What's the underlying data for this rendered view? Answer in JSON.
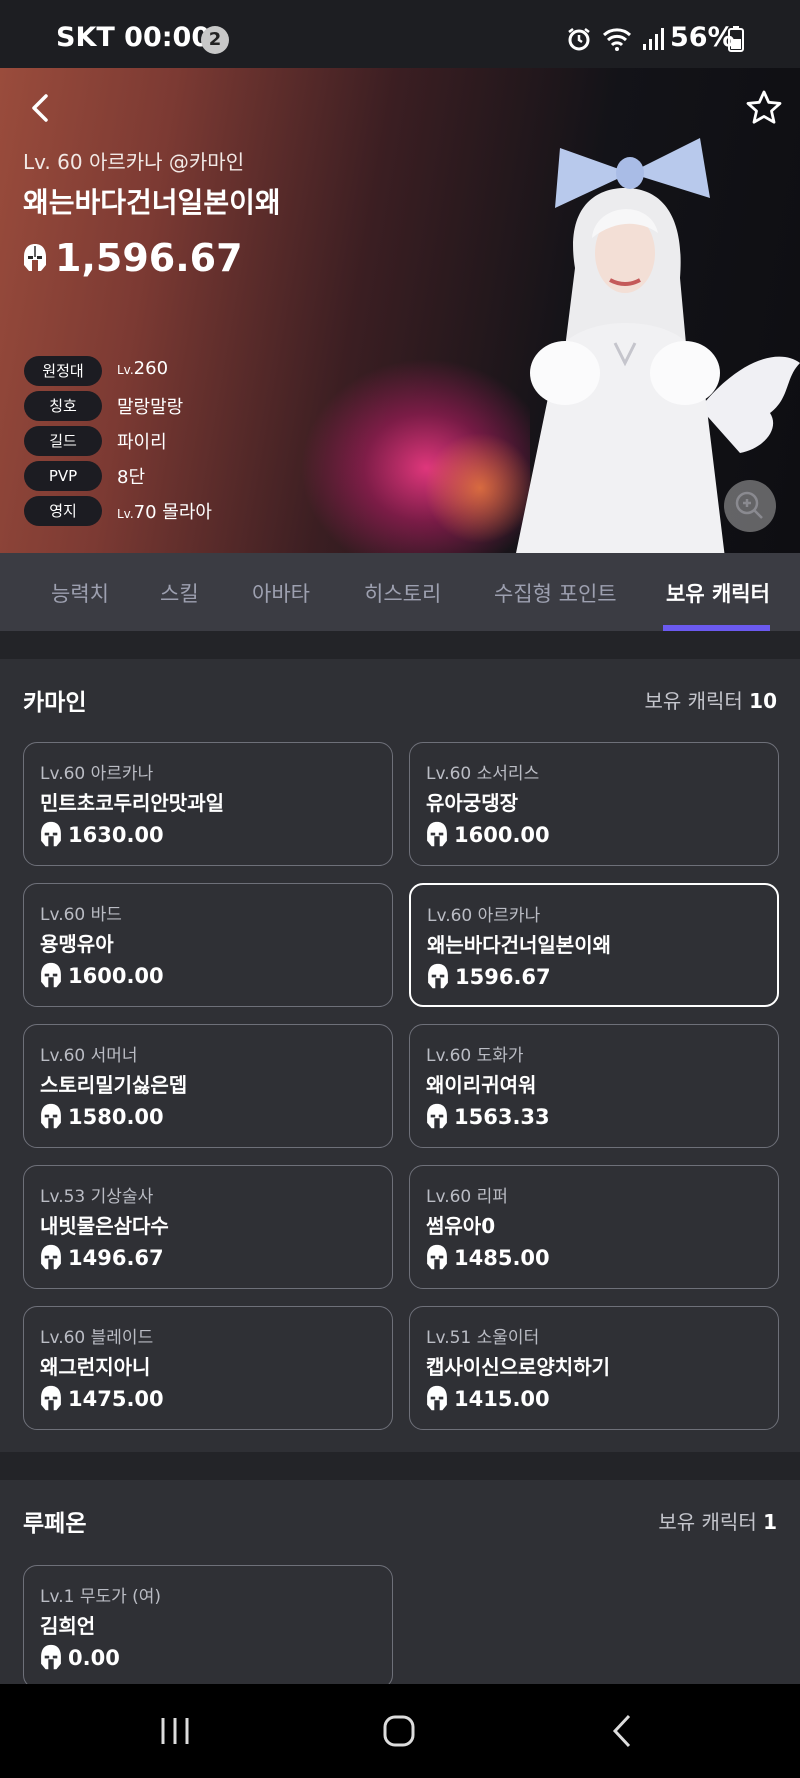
{
  "status_bar": {
    "carrier_time": "SKT 00:00",
    "notification_count": "2",
    "battery": "56%"
  },
  "hero": {
    "class_line": "Lv. 60 아르카나 @카마인",
    "name": "왜는바다건너일본이왜",
    "item_level": "1,596.67",
    "info": [
      {
        "label": "원정대",
        "prefix": "Lv.",
        "value": "260"
      },
      {
        "label": "칭호",
        "prefix": "",
        "value": "말랑말랑"
      },
      {
        "label": "길드",
        "prefix": "",
        "value": "파이리"
      },
      {
        "label": "PVP",
        "prefix": "",
        "value": "8단"
      },
      {
        "label": "영지",
        "prefix": "Lv.",
        "value": "70 몰라아"
      }
    ]
  },
  "tabs": [
    "능력치",
    "스킬",
    "아바타",
    "히스토리",
    "수집형 포인트",
    "보유 캐릭터"
  ],
  "active_tab": "보유 캐릭터",
  "servers": [
    {
      "name": "카마인",
      "count_label": "보유 캐릭터",
      "count": "10",
      "characters": [
        {
          "cls": "Lv.60 아르카나",
          "name": "민트초코두리안맛과일",
          "level": "1630.00"
        },
        {
          "cls": "Lv.60 소서리스",
          "name": "유아궁댕장",
          "level": "1600.00"
        },
        {
          "cls": "Lv.60 바드",
          "name": "용맹유아",
          "level": "1600.00"
        },
        {
          "cls": "Lv.60 아르카나",
          "name": "왜는바다건너일본이왜",
          "level": "1596.67"
        },
        {
          "cls": "Lv.60 서머너",
          "name": "스토리밀기싫은뎁",
          "level": "1580.00"
        },
        {
          "cls": "Lv.60 도화가",
          "name": "왜이리귀여워",
          "level": "1563.33"
        },
        {
          "cls": "Lv.53 기상술사",
          "name": "내빗물은삼다수",
          "level": "1496.67"
        },
        {
          "cls": "Lv.60 리퍼",
          "name": "썸유아0",
          "level": "1485.00"
        },
        {
          "cls": "Lv.60 블레이드",
          "name": "왜그런지아니",
          "level": "1475.00"
        },
        {
          "cls": "Lv.51 소울이터",
          "name": "캡사이신으로양치하기",
          "level": "1415.00"
        }
      ]
    },
    {
      "name": "루페온",
      "count_label": "보유 캐릭터",
      "count": "1",
      "characters": [
        {
          "cls": "Lv.1 무도가 (여)",
          "name": "김희언",
          "level": "0.00"
        }
      ]
    }
  ],
  "colors": {
    "accent": "#6b5af0",
    "background": "#2f3035",
    "tab_bar": "#3b3c43"
  }
}
